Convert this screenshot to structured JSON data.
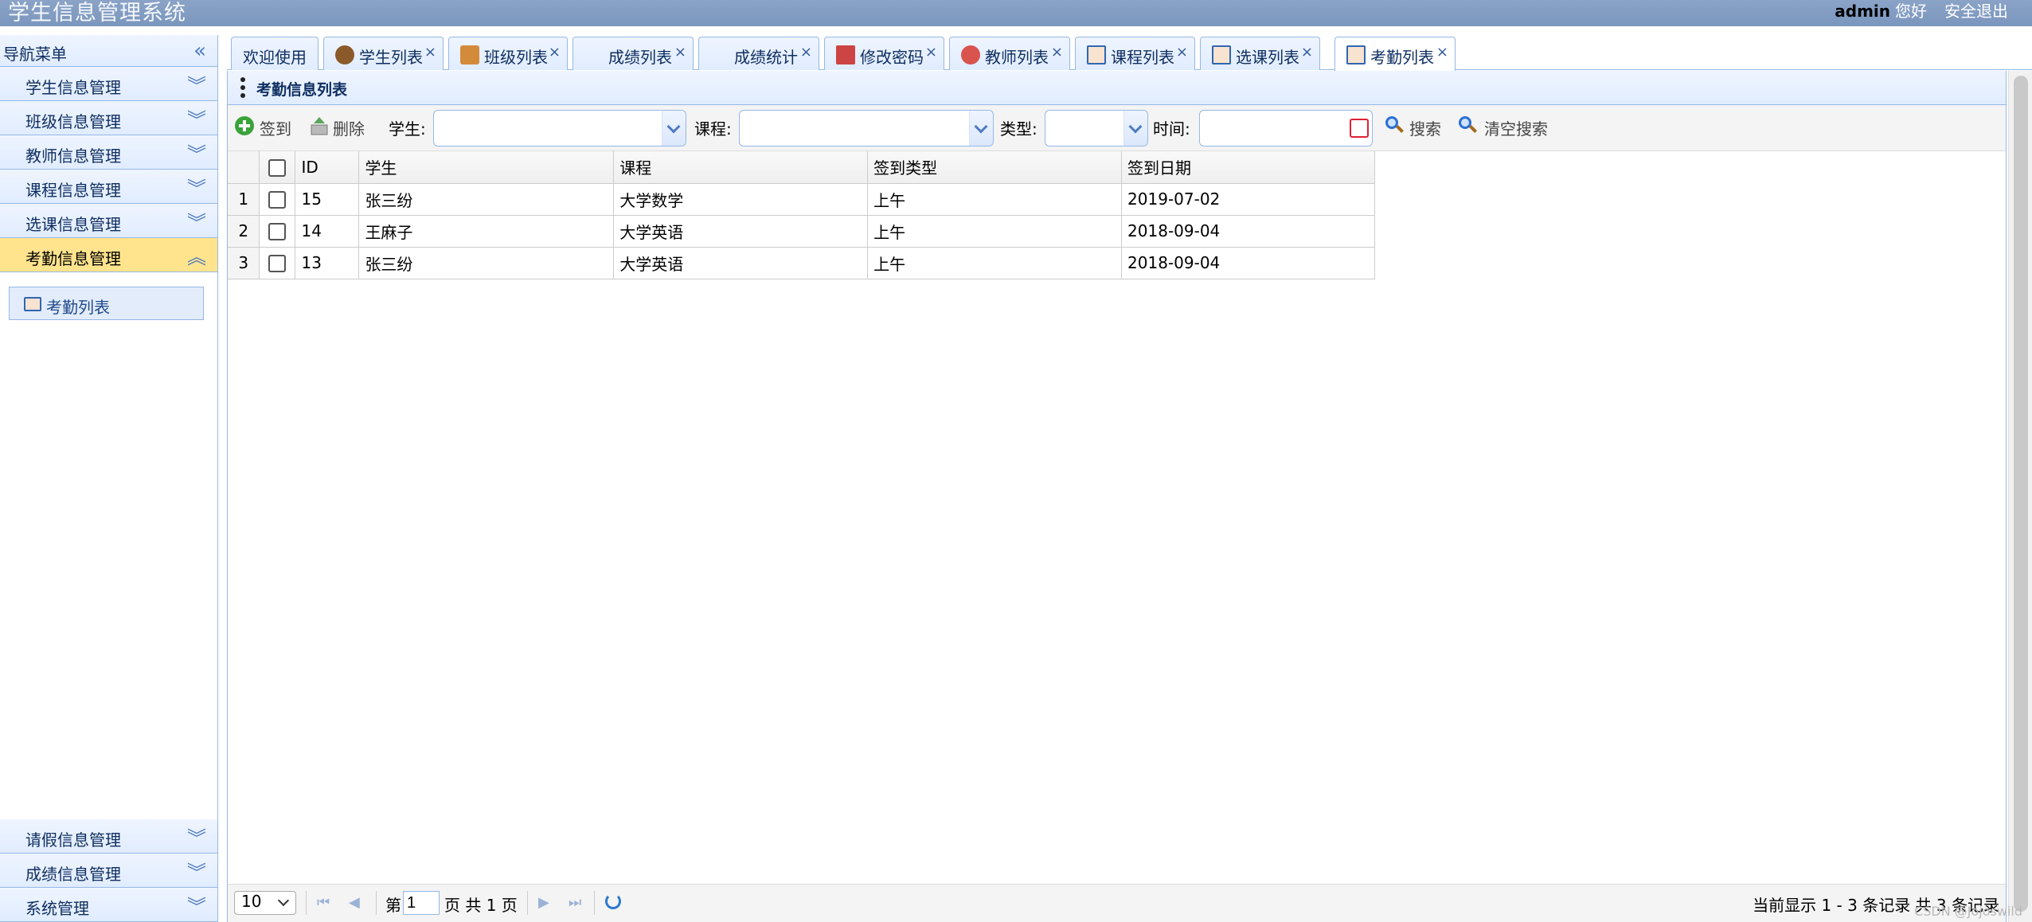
{
  "header": {
    "title": "学生信息管理系统",
    "user": "admin",
    "greeting": "您好",
    "logout": "安全退出"
  },
  "sidebar": {
    "title": "导航菜单",
    "items": [
      {
        "label": "学生信息管理"
      },
      {
        "label": "班级信息管理"
      },
      {
        "label": "教师信息管理"
      },
      {
        "label": "课程信息管理"
      },
      {
        "label": "选课信息管理"
      },
      {
        "label": "考勤信息管理"
      }
    ],
    "active_child": "考勤列表",
    "bottom_items": [
      {
        "label": "请假信息管理"
      },
      {
        "label": "成绩信息管理"
      },
      {
        "label": "系统管理"
      }
    ]
  },
  "tabs": [
    {
      "label": "欢迎使用"
    },
    {
      "label": "学生列表"
    },
    {
      "label": "班级列表"
    },
    {
      "label": "成绩列表"
    },
    {
      "label": "成绩统计"
    },
    {
      "label": "修改密码"
    },
    {
      "label": "教师列表"
    },
    {
      "label": "课程列表"
    },
    {
      "label": "选课列表"
    },
    {
      "label": "考勤列表"
    }
  ],
  "tab_close": "×",
  "panel": {
    "title": "考勤信息列表"
  },
  "toolbar": {
    "signin": "签到",
    "delete": "删除",
    "student_label": "学生:",
    "course_label": "课程:",
    "type_label": "类型:",
    "time_label": "时间:",
    "search": "搜索",
    "clear_search": "清空搜索"
  },
  "grid": {
    "columns": [
      "ID",
      "学生",
      "课程",
      "签到类型",
      "签到日期"
    ],
    "rows": [
      {
        "n": "1",
        "id": "15",
        "student": "张三纷",
        "course": "大学数学",
        "type": "上午",
        "date": "2019-07-02"
      },
      {
        "n": "2",
        "id": "14",
        "student": "王麻子",
        "course": "大学英语",
        "type": "上午",
        "date": "2018-09-04"
      },
      {
        "n": "3",
        "id": "13",
        "student": "张三纷",
        "course": "大学英语",
        "type": "上午",
        "date": "2018-09-04"
      }
    ]
  },
  "pager": {
    "page_size": "10",
    "page_prefix": "第",
    "page_value": "1",
    "page_suffix": "页 共 1 页",
    "info": "当前显示 1 - 3 条记录 共 3 条记录"
  },
  "watermark": "CSDN @Jojoswild",
  "colors": {
    "header": "#7b96bd",
    "border": "#95b8e7",
    "active_menu": "#ffe48d"
  }
}
